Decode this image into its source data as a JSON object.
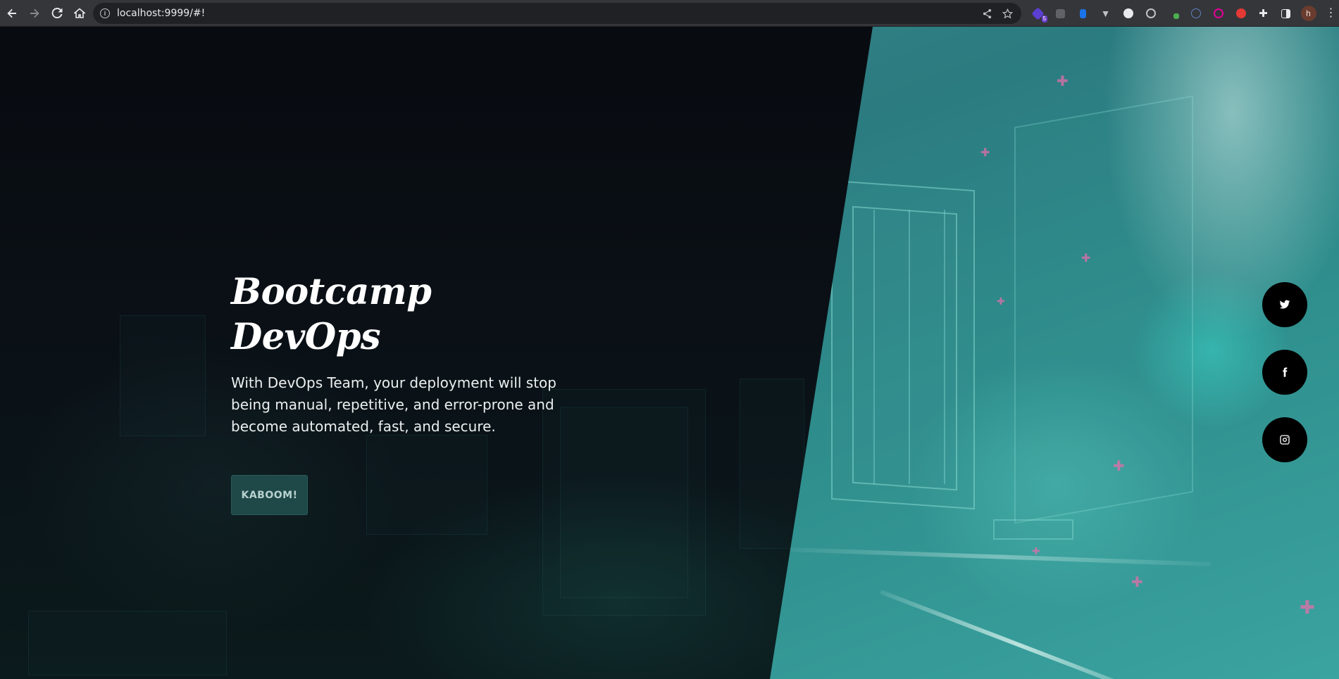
{
  "browser": {
    "url": "localhost:9999/#!",
    "extension_badge": "5",
    "profile_initial": "h"
  },
  "hero": {
    "title": "Bootcamp DevOps",
    "description": "With DevOps Team, your deployment will stop being manual, repetitive, and error-prone and become automated, fast, and secure.",
    "button_label": "KABOOM!"
  },
  "social": [
    {
      "name": "twitter",
      "icon": "twitter-icon"
    },
    {
      "name": "facebook",
      "icon": "facebook-icon"
    },
    {
      "name": "instagram",
      "icon": "instagram-icon"
    }
  ],
  "colors": {
    "accent_teal": "#2b7b80",
    "button_bg": "#1f4848",
    "dark_bg": "#0b0f14"
  }
}
